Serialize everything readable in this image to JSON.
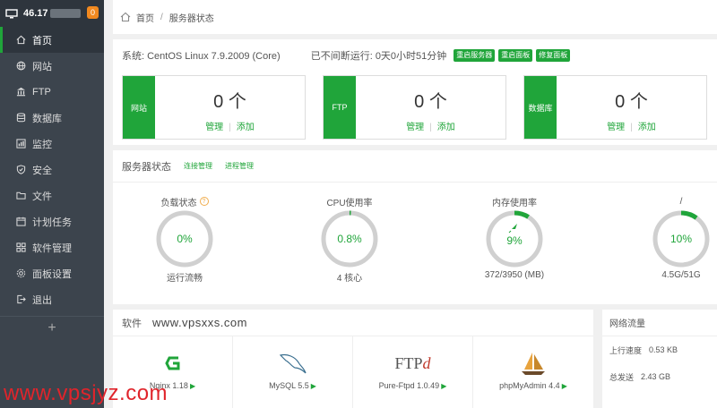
{
  "sidebar": {
    "ip": "46.17",
    "badge": "0",
    "items": [
      {
        "label": "首页",
        "icon": "home-icon",
        "active": true
      },
      {
        "label": "网站",
        "icon": "globe-icon"
      },
      {
        "label": "FTP",
        "icon": "ftp-icon"
      },
      {
        "label": "数据库",
        "icon": "database-icon"
      },
      {
        "label": "监控",
        "icon": "monitor-icon"
      },
      {
        "label": "安全",
        "icon": "shield-icon"
      },
      {
        "label": "文件",
        "icon": "folder-icon"
      },
      {
        "label": "计划任务",
        "icon": "calendar-icon"
      },
      {
        "label": "软件管理",
        "icon": "grid-icon"
      },
      {
        "label": "面板设置",
        "icon": "gear-icon"
      },
      {
        "label": "退出",
        "icon": "logout-icon"
      }
    ],
    "add": "+"
  },
  "breadcrumb": {
    "home": "首页",
    "sep": "/",
    "current": "服务器状态"
  },
  "system": {
    "os": "系统: CentOS Linux 7.9.2009 (Core)",
    "uptime": "已不间断运行: 0天0小时51分钟",
    "buttons": [
      "重启服务器",
      "重启面板",
      "修复面板"
    ]
  },
  "stats": [
    {
      "tag": "网站",
      "count": "0 个",
      "manage": "管理",
      "divider": "|",
      "add": "添加"
    },
    {
      "tag": "FTP",
      "count": "0 个",
      "manage": "管理",
      "divider": "|",
      "add": "添加"
    },
    {
      "tag": "数据库",
      "count": "0 个",
      "manage": "管理",
      "divider": "|",
      "add": "添加"
    }
  ],
  "status": {
    "title": "服务器状态",
    "links": [
      "连接管理",
      "进程管理"
    ],
    "gauges": [
      {
        "title": "负载状态",
        "help": "?",
        "value": "0%",
        "fraction": 0.0,
        "foot": "运行流畅"
      },
      {
        "title": "CPU使用率",
        "value": "0.8%",
        "fraction": 0.008,
        "foot": "4 核心"
      },
      {
        "title": "内存使用率",
        "value": "9%",
        "fraction": 0.09,
        "foot": "372/3950 (MB)"
      },
      {
        "title": "/",
        "value": "10%",
        "fraction": 0.1,
        "foot": "4.5G/51G"
      }
    ]
  },
  "software": {
    "title": "软件",
    "watermark": "www.vpsxxs.com",
    "items": [
      {
        "name": "Nginx 1.18",
        "play": "▶",
        "logo": "nginx-logo-icon"
      },
      {
        "name": "MySQL 5.5",
        "play": "▶",
        "logo": "mysql-dolphin-icon"
      },
      {
        "name": "Pure-Ftpd 1.0.49",
        "play": "▶",
        "logo": "ftpd-logo-icon",
        "logo_text": "FTP",
        "logo_sub": "d"
      },
      {
        "name": "phpMyAdmin 4.4",
        "play": "▶",
        "logo": "sailboat-icon"
      }
    ]
  },
  "network": {
    "title": "网络流量",
    "rows": [
      {
        "label": "上行速度",
        "value": "0.53 KB"
      },
      {
        "label": "总发送",
        "value": "2.43 GB"
      }
    ]
  },
  "overlay_watermark": "www.vpsjyz.com",
  "colors": {
    "accent": "#20a53a",
    "sidebar": "#3c444d",
    "badge": "#f2891f",
    "watermark": "#e0242b"
  }
}
